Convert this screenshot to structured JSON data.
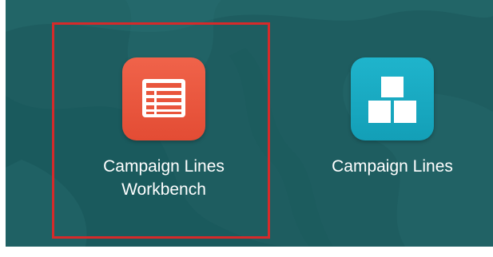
{
  "tiles": [
    {
      "label_line1": "Campaign Lines",
      "label_line2": "Workbench",
      "icon": "table-icon",
      "icon_color": "#e9553c",
      "highlighted": true
    },
    {
      "label_line1": "Campaign Lines",
      "icon": "stacked-blocks-icon",
      "icon_color": "#1aaac2"
    }
  ],
  "colors": {
    "background": "#1e5d60",
    "highlight_border": "#d62a2a",
    "label": "#ffffff"
  }
}
